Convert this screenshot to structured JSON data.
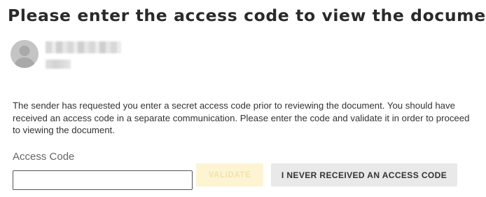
{
  "header": {
    "title": "Please enter the access code to view the document"
  },
  "sender": {
    "avatar_icon": "user-avatar-icon"
  },
  "main": {
    "description": "The sender has requested you enter a secret access code prior to reviewing the document. You should have received an access code in a separate communication. Please enter the code and validate it in order to proceed to viewing the document.",
    "access_code_label": "Access Code",
    "access_code_value": "",
    "validate_label": "VALIDATE",
    "validate_state": "disabled",
    "never_received_label": "I NEVER RECEIVED AN ACCESS CODE"
  },
  "colors": {
    "validate_bg": "#fdf4d3",
    "secondary_bg": "#e9e9e9",
    "text": "#333333"
  }
}
